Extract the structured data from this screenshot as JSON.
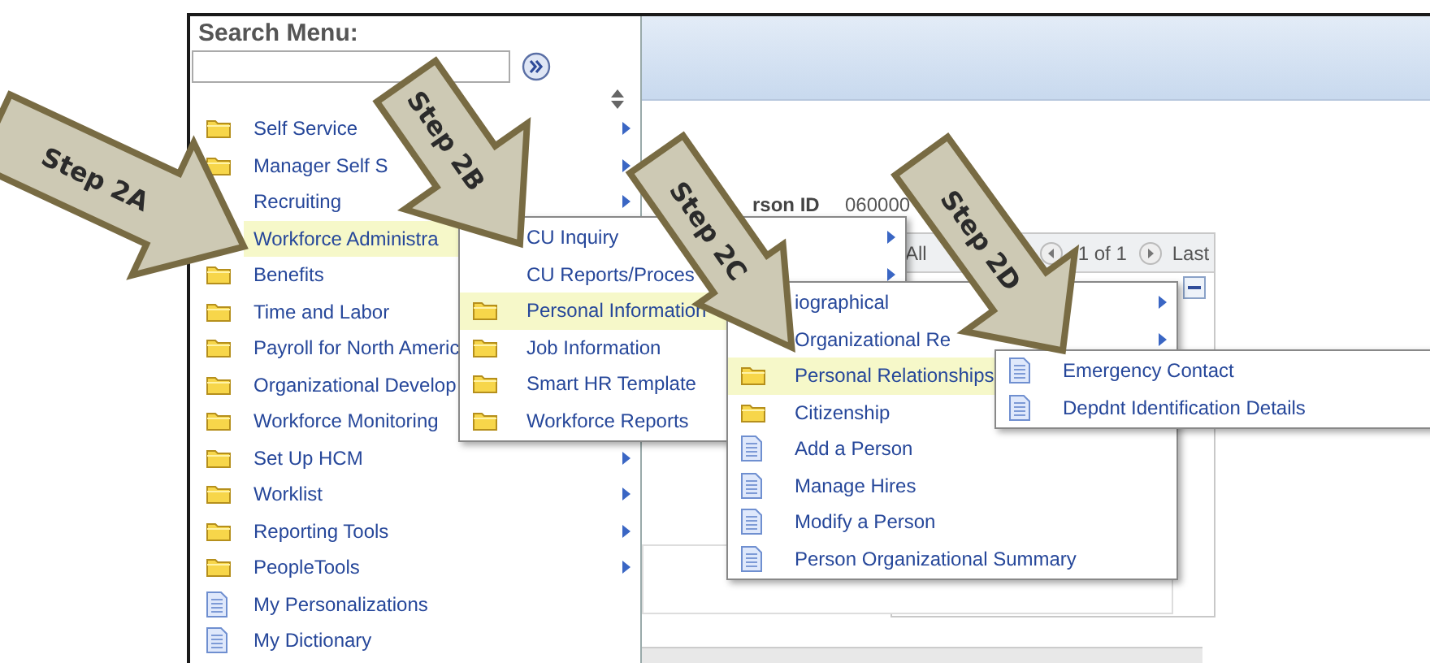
{
  "search_menu": {
    "label": "Search Menu:"
  },
  "menus": [
    {
      "items": [
        {
          "label": "Self Service",
          "kind": "folder",
          "arrow": true,
          "selected": false
        },
        {
          "label": "Manager Self S",
          "kind": "folder",
          "arrow": true,
          "selected": false
        },
        {
          "label": "Recruiting",
          "kind": "plain",
          "arrow": true,
          "selected": false
        },
        {
          "label": "Workforce Administra",
          "kind": "plain",
          "arrow": false,
          "selected": true
        },
        {
          "label": "Benefits",
          "kind": "folder",
          "arrow": false,
          "selected": false
        },
        {
          "label": "Time and Labor",
          "kind": "folder",
          "arrow": false,
          "selected": false
        },
        {
          "label": "Payroll for North Americ",
          "kind": "folder",
          "arrow": false,
          "selected": false
        },
        {
          "label": "Organizational Develop",
          "kind": "folder",
          "arrow": false,
          "selected": false
        },
        {
          "label": "Workforce Monitoring",
          "kind": "folder",
          "arrow": false,
          "selected": false
        },
        {
          "label": "Set Up HCM",
          "kind": "folder",
          "arrow": true,
          "selected": false
        },
        {
          "label": "Worklist",
          "kind": "folder",
          "arrow": true,
          "selected": false
        },
        {
          "label": "Reporting Tools",
          "kind": "folder",
          "arrow": true,
          "selected": false
        },
        {
          "label": "PeopleTools",
          "kind": "folder",
          "arrow": true,
          "selected": false
        },
        {
          "label": "My Personalizations",
          "kind": "page",
          "arrow": false,
          "selected": false
        },
        {
          "label": "My Dictionary",
          "kind": "page",
          "arrow": false,
          "selected": false
        }
      ]
    },
    {
      "items": [
        {
          "label": "CU Inquiry",
          "kind": "plain",
          "arrow": true,
          "selected": false
        },
        {
          "label": "CU Reports/Proces",
          "kind": "plain",
          "arrow": true,
          "selected": false
        },
        {
          "label": "Personal Information",
          "kind": "folder",
          "arrow": false,
          "selected": true
        },
        {
          "label": "Job Information",
          "kind": "folder",
          "arrow": false,
          "selected": false
        },
        {
          "label": "Smart HR Template",
          "kind": "folder",
          "arrow": false,
          "selected": false
        },
        {
          "label": "Workforce Reports",
          "kind": "folder",
          "arrow": false,
          "selected": false
        }
      ]
    },
    {
      "items": [
        {
          "label": "iographical",
          "kind": "plain",
          "arrow": true,
          "selected": false
        },
        {
          "label": "Organizational Re",
          "kind": "plain",
          "arrow": true,
          "selected": false
        },
        {
          "label": "Personal Relationships",
          "kind": "folder",
          "arrow": false,
          "selected": true
        },
        {
          "label": "Citizenship",
          "kind": "folder",
          "arrow": false,
          "selected": false
        },
        {
          "label": "Add a Person",
          "kind": "page",
          "arrow": false,
          "selected": false
        },
        {
          "label": "Manage Hires",
          "kind": "page",
          "arrow": false,
          "selected": false
        },
        {
          "label": "Modify a Person",
          "kind": "page",
          "arrow": false,
          "selected": false
        },
        {
          "label": "Person Organizational Summary",
          "kind": "page",
          "arrow": false,
          "selected": false
        }
      ]
    },
    {
      "items": [
        {
          "label": "Emergency Contact",
          "kind": "page",
          "arrow": false,
          "selected": false
        },
        {
          "label": "Depdnt Identification Details",
          "kind": "page",
          "arrow": false,
          "selected": false
        }
      ]
    }
  ],
  "content": {
    "person_id_label": "rson ID",
    "person_id": "060000",
    "view_all": "All",
    "count": "1 of 1",
    "last": "Last"
  },
  "steps": [
    {
      "label": "Step 2A"
    },
    {
      "label": "Step 2B"
    },
    {
      "label": "Step 2C"
    },
    {
      "label": "Step 2D"
    }
  ]
}
